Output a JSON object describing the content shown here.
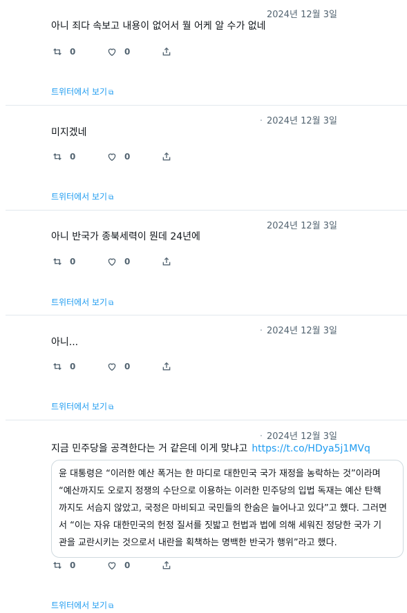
{
  "tweets": [
    {
      "date": "2024년 12월 3일",
      "text": "아니 죄다 속보고 내용이 없어서 뭘 어케 알 수가 없네",
      "retweets": "0",
      "likes": "0",
      "view_label": "트위터에서 보기",
      "link": ""
    },
    {
      "date": "2024년 12월 3일",
      "text": "미지겠네",
      "retweets": "0",
      "likes": "0",
      "view_label": "트위터에서 보기",
      "link": ""
    },
    {
      "date": "2024년 12월 3일",
      "text": "아니 반국가 종북세력이 뭔데 24년에",
      "retweets": "0",
      "likes": "0",
      "view_label": "트위터에서 보기",
      "link": ""
    },
    {
      "date": "2024년 12월 3일",
      "text": "아니...",
      "retweets": "0",
      "likes": "0",
      "view_label": "트위터에서 보기",
      "link": ""
    },
    {
      "date": "2024년 12월 3일",
      "text": "지금 민주당을 공격한다는 거 같은데 이게 맞냐고",
      "retweets": "0",
      "likes": "0",
      "view_label": "트위터에서 보기",
      "link": "https://t.co/HDya5j1MVq",
      "quote_lines": [
        "윤 대통령은 “이러한 예산 폭거는 한 마디로 대한민국 국가 재정을 농락하는 것”이라며",
        "“예산까지도 오로지 정쟁의 수단으로 이용하는 이러한 민주당의 입법 독재는 예산 탄핵",
        "까지도 서슴지 않았고, 국정은 마비되고 국민들의 한숨은 늘어나고 있다”고 했다. 그러면",
        "서 “이는 자유 대한민국의 헌정 질서를 짓밟고 헌법과 법에 의해 세워진 정당한 국가 기",
        "관을 교란시키는 것으로서 내란을 획책하는 명백한 반국가 행위”라고 했다."
      ]
    }
  ],
  "icons": {
    "retweet": "retweet-icon",
    "like": "heart-icon",
    "share": "share-icon",
    "external": "external-link-icon"
  },
  "colors": {
    "link": "#1d9bf0",
    "muted": "#536471",
    "divider": "#e1e8ed"
  }
}
